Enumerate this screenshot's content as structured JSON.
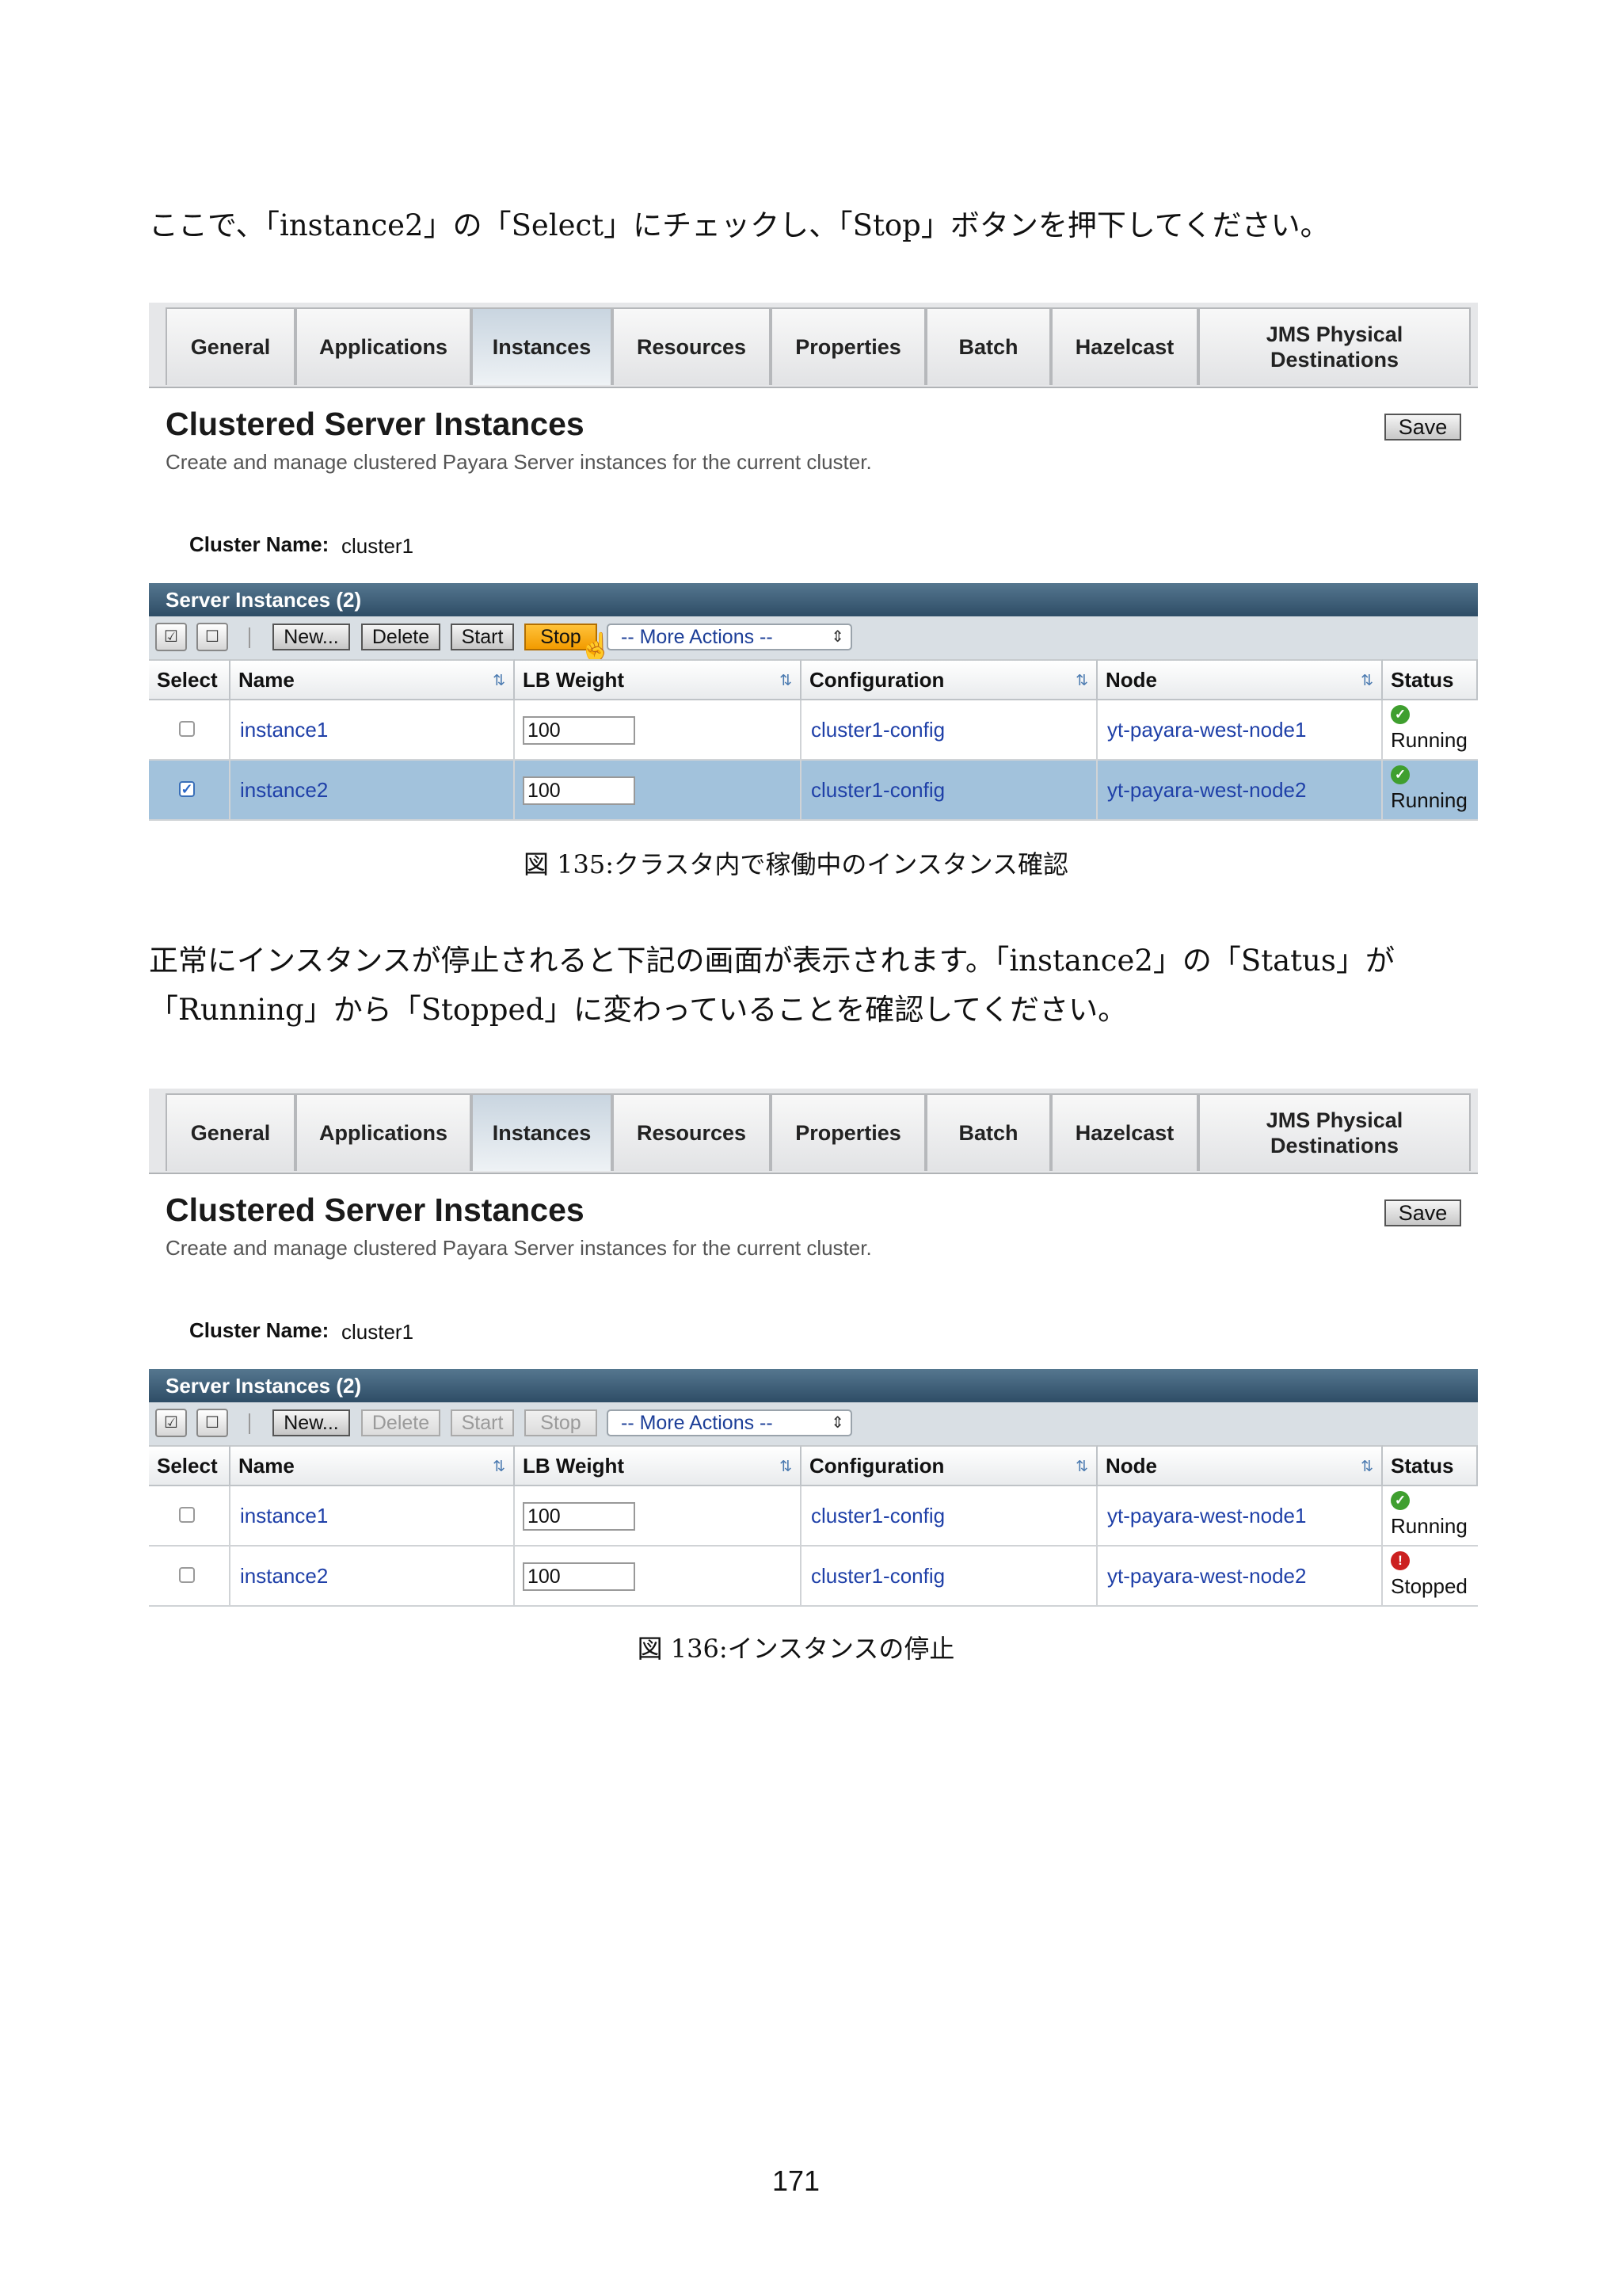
{
  "intro_text": "ここで、「instance2」の「Select」にチェックし、「Stop」ボタンを押下してください。",
  "middle_text_line1": "正常にインスタンスが停止されると下記の画面が表示されます。「instance2」の「Status」が",
  "middle_text_line2": "「Running」から「Stopped」に変わっていることを確認してください。",
  "page_number": "171",
  "figures": [
    {
      "caption": "図 135:クラスタ内で稼働中のインスタンス確認",
      "tabs": [
        "General",
        "Applications",
        "Instances",
        "Resources",
        "Properties",
        "Batch",
        "Hazelcast",
        "JMS Physical Destinations"
      ],
      "active_tab": "Instances",
      "title": "Clustered Server Instances",
      "subtitle": "Create and manage clustered Payara Server instances for the current cluster.",
      "save_label": "Save",
      "cluster_label": "Cluster Name:",
      "cluster_name": "cluster1",
      "table_title": "Server Instances (2)",
      "buttons": {
        "new": "New...",
        "delete": "Delete",
        "start": "Start",
        "stop": "Stop"
      },
      "button_state": {
        "delete_enabled": true,
        "start_enabled": true,
        "stop_enabled": true,
        "stop_highlighted": true
      },
      "more_actions": "-- More Actions --",
      "columns": [
        "Select",
        "Name",
        "LB Weight",
        "Configuration",
        "Node",
        "Status"
      ],
      "rows": [
        {
          "checked": false,
          "name": "instance1",
          "lb_weight": "100",
          "configuration": "cluster1-config",
          "node": "yt-payara-west-node1",
          "status": "Running",
          "status_icon": "check-circle-icon"
        },
        {
          "checked": true,
          "name": "instance2",
          "lb_weight": "100",
          "configuration": "cluster1-config",
          "node": "yt-payara-west-node2",
          "status": "Running",
          "status_icon": "check-circle-icon"
        }
      ]
    },
    {
      "caption": "図 136:インスタンスの停止",
      "tabs": [
        "General",
        "Applications",
        "Instances",
        "Resources",
        "Properties",
        "Batch",
        "Hazelcast",
        "JMS Physical Destinations"
      ],
      "active_tab": "Instances",
      "title": "Clustered Server Instances",
      "subtitle": "Create and manage clustered Payara Server instances for the current cluster.",
      "save_label": "Save",
      "cluster_label": "Cluster Name:",
      "cluster_name": "cluster1",
      "table_title": "Server Instances (2)",
      "buttons": {
        "new": "New...",
        "delete": "Delete",
        "start": "Start",
        "stop": "Stop"
      },
      "button_state": {
        "delete_enabled": false,
        "start_enabled": false,
        "stop_enabled": false,
        "stop_highlighted": false
      },
      "more_actions": "-- More Actions --",
      "columns": [
        "Select",
        "Name",
        "LB Weight",
        "Configuration",
        "Node",
        "Status"
      ],
      "rows": [
        {
          "checked": false,
          "name": "instance1",
          "lb_weight": "100",
          "configuration": "cluster1-config",
          "node": "yt-payara-west-node1",
          "status": "Running",
          "status_icon": "check-circle-icon"
        },
        {
          "checked": false,
          "name": "instance2",
          "lb_weight": "100",
          "configuration": "cluster1-config",
          "node": "yt-payara-west-node2",
          "status": "Stopped",
          "status_icon": "error-circle-icon"
        }
      ]
    }
  ],
  "colors": {
    "header_bar": "#3a5a75",
    "selected_row": "#a2c2dc",
    "link": "#1f40a8",
    "stop_button": "#f5a300",
    "running_icon": "#3f9f2f",
    "stopped_icon": "#cc2020"
  }
}
